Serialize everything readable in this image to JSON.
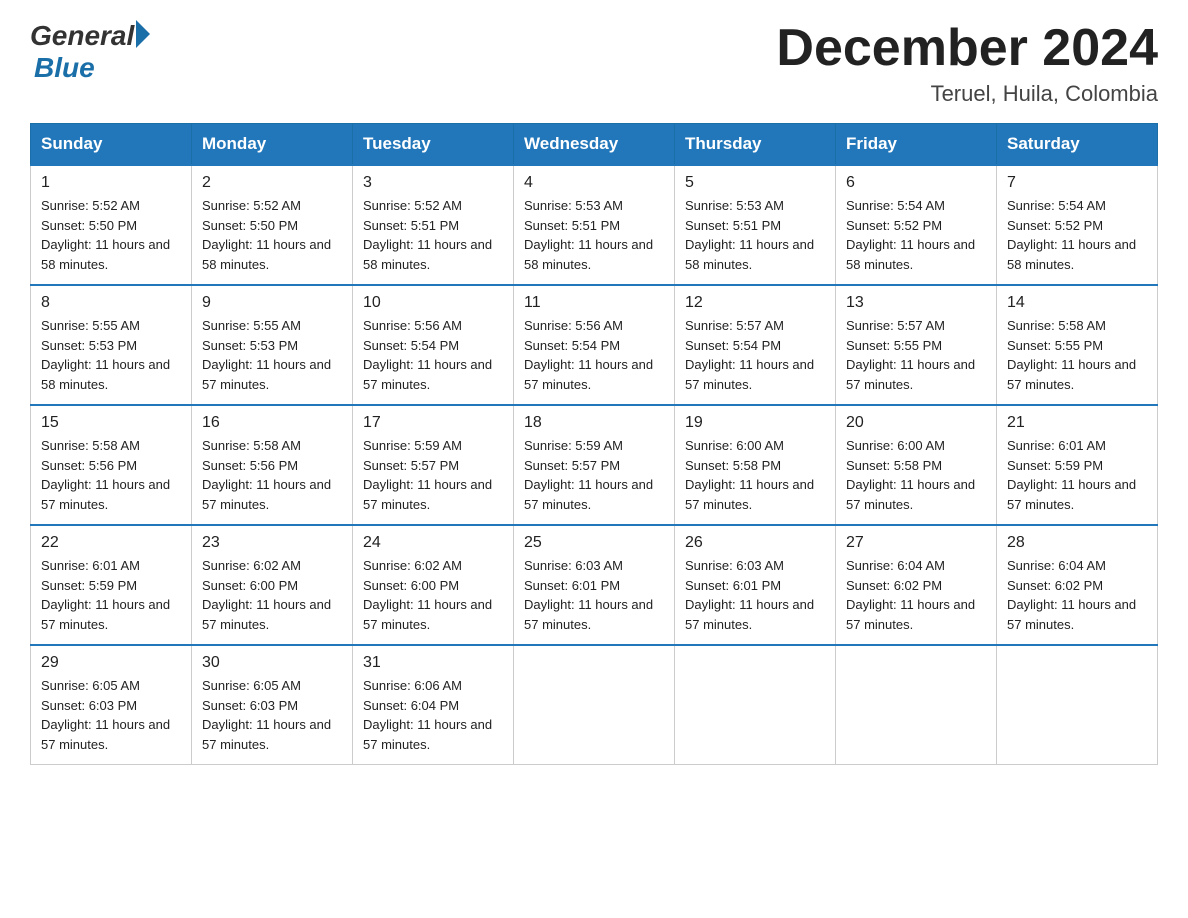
{
  "header": {
    "logo": {
      "general_text": "General",
      "blue_text": "Blue"
    },
    "title": "December 2024",
    "location": "Teruel, Huila, Colombia"
  },
  "days_of_week": [
    "Sunday",
    "Monday",
    "Tuesday",
    "Wednesday",
    "Thursday",
    "Friday",
    "Saturday"
  ],
  "weeks": [
    [
      {
        "day": "1",
        "sunrise": "5:52 AM",
        "sunset": "5:50 PM",
        "daylight": "11 hours and 58 minutes."
      },
      {
        "day": "2",
        "sunrise": "5:52 AM",
        "sunset": "5:50 PM",
        "daylight": "11 hours and 58 minutes."
      },
      {
        "day": "3",
        "sunrise": "5:52 AM",
        "sunset": "5:51 PM",
        "daylight": "11 hours and 58 minutes."
      },
      {
        "day": "4",
        "sunrise": "5:53 AM",
        "sunset": "5:51 PM",
        "daylight": "11 hours and 58 minutes."
      },
      {
        "day": "5",
        "sunrise": "5:53 AM",
        "sunset": "5:51 PM",
        "daylight": "11 hours and 58 minutes."
      },
      {
        "day": "6",
        "sunrise": "5:54 AM",
        "sunset": "5:52 PM",
        "daylight": "11 hours and 58 minutes."
      },
      {
        "day": "7",
        "sunrise": "5:54 AM",
        "sunset": "5:52 PM",
        "daylight": "11 hours and 58 minutes."
      }
    ],
    [
      {
        "day": "8",
        "sunrise": "5:55 AM",
        "sunset": "5:53 PM",
        "daylight": "11 hours and 58 minutes."
      },
      {
        "day": "9",
        "sunrise": "5:55 AM",
        "sunset": "5:53 PM",
        "daylight": "11 hours and 57 minutes."
      },
      {
        "day": "10",
        "sunrise": "5:56 AM",
        "sunset": "5:54 PM",
        "daylight": "11 hours and 57 minutes."
      },
      {
        "day": "11",
        "sunrise": "5:56 AM",
        "sunset": "5:54 PM",
        "daylight": "11 hours and 57 minutes."
      },
      {
        "day": "12",
        "sunrise": "5:57 AM",
        "sunset": "5:54 PM",
        "daylight": "11 hours and 57 minutes."
      },
      {
        "day": "13",
        "sunrise": "5:57 AM",
        "sunset": "5:55 PM",
        "daylight": "11 hours and 57 minutes."
      },
      {
        "day": "14",
        "sunrise": "5:58 AM",
        "sunset": "5:55 PM",
        "daylight": "11 hours and 57 minutes."
      }
    ],
    [
      {
        "day": "15",
        "sunrise": "5:58 AM",
        "sunset": "5:56 PM",
        "daylight": "11 hours and 57 minutes."
      },
      {
        "day": "16",
        "sunrise": "5:58 AM",
        "sunset": "5:56 PM",
        "daylight": "11 hours and 57 minutes."
      },
      {
        "day": "17",
        "sunrise": "5:59 AM",
        "sunset": "5:57 PM",
        "daylight": "11 hours and 57 minutes."
      },
      {
        "day": "18",
        "sunrise": "5:59 AM",
        "sunset": "5:57 PM",
        "daylight": "11 hours and 57 minutes."
      },
      {
        "day": "19",
        "sunrise": "6:00 AM",
        "sunset": "5:58 PM",
        "daylight": "11 hours and 57 minutes."
      },
      {
        "day": "20",
        "sunrise": "6:00 AM",
        "sunset": "5:58 PM",
        "daylight": "11 hours and 57 minutes."
      },
      {
        "day": "21",
        "sunrise": "6:01 AM",
        "sunset": "5:59 PM",
        "daylight": "11 hours and 57 minutes."
      }
    ],
    [
      {
        "day": "22",
        "sunrise": "6:01 AM",
        "sunset": "5:59 PM",
        "daylight": "11 hours and 57 minutes."
      },
      {
        "day": "23",
        "sunrise": "6:02 AM",
        "sunset": "6:00 PM",
        "daylight": "11 hours and 57 minutes."
      },
      {
        "day": "24",
        "sunrise": "6:02 AM",
        "sunset": "6:00 PM",
        "daylight": "11 hours and 57 minutes."
      },
      {
        "day": "25",
        "sunrise": "6:03 AM",
        "sunset": "6:01 PM",
        "daylight": "11 hours and 57 minutes."
      },
      {
        "day": "26",
        "sunrise": "6:03 AM",
        "sunset": "6:01 PM",
        "daylight": "11 hours and 57 minutes."
      },
      {
        "day": "27",
        "sunrise": "6:04 AM",
        "sunset": "6:02 PM",
        "daylight": "11 hours and 57 minutes."
      },
      {
        "day": "28",
        "sunrise": "6:04 AM",
        "sunset": "6:02 PM",
        "daylight": "11 hours and 57 minutes."
      }
    ],
    [
      {
        "day": "29",
        "sunrise": "6:05 AM",
        "sunset": "6:03 PM",
        "daylight": "11 hours and 57 minutes."
      },
      {
        "day": "30",
        "sunrise": "6:05 AM",
        "sunset": "6:03 PM",
        "daylight": "11 hours and 57 minutes."
      },
      {
        "day": "31",
        "sunrise": "6:06 AM",
        "sunset": "6:04 PM",
        "daylight": "11 hours and 57 minutes."
      },
      null,
      null,
      null,
      null
    ]
  ]
}
